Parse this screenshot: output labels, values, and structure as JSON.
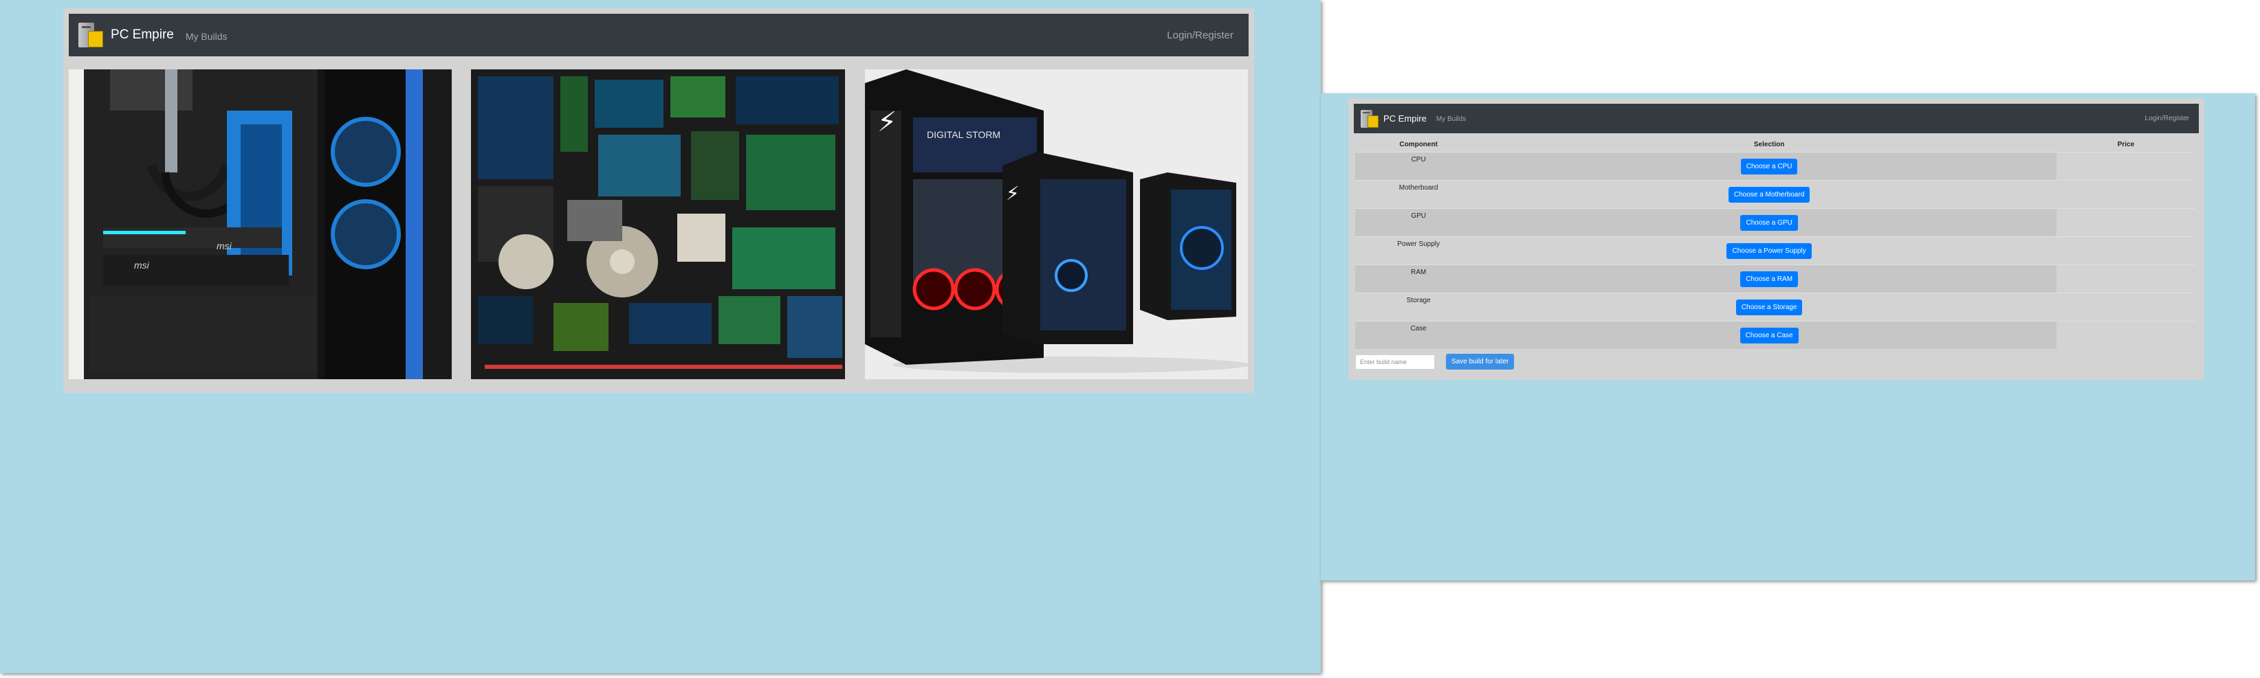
{
  "windows": [
    {
      "navbar": {
        "brand": "PC Empire",
        "my_builds": "My Builds",
        "login": "Login/Register"
      },
      "carousel": {
        "images": [
          "Open PC case with liquid cooling and MSI graphics card",
          "Flat lay of assorted computer hardware components",
          "Digital Storm gaming PC towers with RGB lighting"
        ]
      }
    },
    {
      "navbar": {
        "brand": "PC Empire",
        "my_builds": "My Builds",
        "login": "Login/Register"
      },
      "table": {
        "headers": {
          "component": "Component",
          "selection": "Selection",
          "price": "Price"
        },
        "rows": [
          {
            "component": "CPU",
            "button": "Choose a CPU"
          },
          {
            "component": "Motherboard",
            "button": "Choose a Motherboard"
          },
          {
            "component": "GPU",
            "button": "Choose a GPU"
          },
          {
            "component": "Power Supply",
            "button": "Choose a Power Supply"
          },
          {
            "component": "RAM",
            "button": "Choose a RAM"
          },
          {
            "component": "Storage",
            "button": "Choose a Storage"
          },
          {
            "component": "Case",
            "button": "Choose a Case"
          }
        ]
      },
      "build_name_placeholder": "Enter build name",
      "save_button": "Save build for later"
    }
  ],
  "colors": {
    "page_background": "#add8e6",
    "card": "#d3d3d3",
    "navbar": "#343a40",
    "primary": "#007bff"
  },
  "photo_labels": {
    "msi": "msi",
    "brand": "DIGITAL STORM"
  }
}
